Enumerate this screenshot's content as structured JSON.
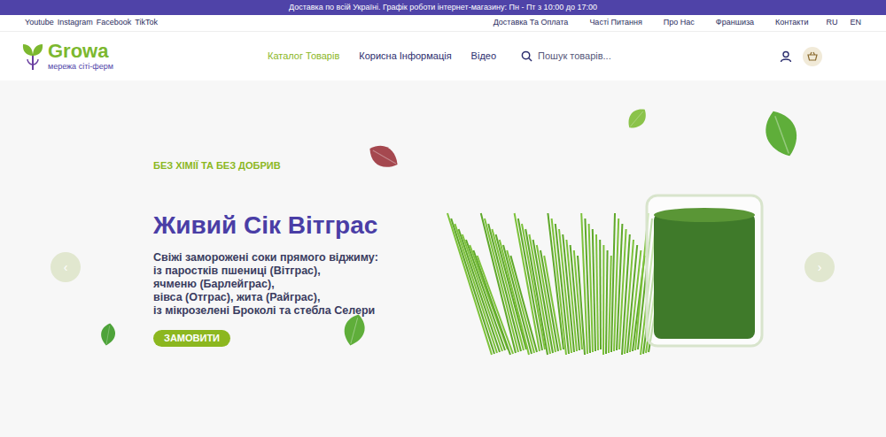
{
  "announcement": "Доставка по всій Україні. Графік роботи інтернет-магазину: Пн - Пт  з 10:00 до 17:00",
  "social_links": [
    "Youtube",
    "Instagram",
    "Facebook",
    "TikTok"
  ],
  "top_links": [
    "Доставка Та Оплата",
    "Часті Питання",
    "Про Нас",
    "Франшиза",
    "Контакти"
  ],
  "languages": [
    {
      "label": "RU",
      "selected": false
    },
    {
      "label": "EN",
      "selected": false
    }
  ],
  "logo": {
    "name": "Growa",
    "tagline": "мережа сіті-ферм"
  },
  "nav": [
    {
      "label": "Каталог Товарів",
      "selected": true
    },
    {
      "label": "Корисна Інформація",
      "selected": false
    },
    {
      "label": "Відео",
      "selected": false
    }
  ],
  "search": {
    "placeholder": "Пошук товарів..."
  },
  "hero": {
    "eyebrow": "БЕЗ ХІМІЇ ТА БЕЗ ДОБРИВ",
    "title": "Живий Сік Вітграс",
    "lines": [
      "Свіжі заморожені соки прямого віджиму:",
      "із паростків пшениці (Вітграс),",
      "ячменю (Барлейграс),",
      "вівса (Отграс), жита (Райграс),",
      "із мікрозелені Броколі та стебла Селери"
    ],
    "button": "ЗАМОВИТИ"
  },
  "slider": {
    "prev": "‹",
    "next": "›"
  }
}
